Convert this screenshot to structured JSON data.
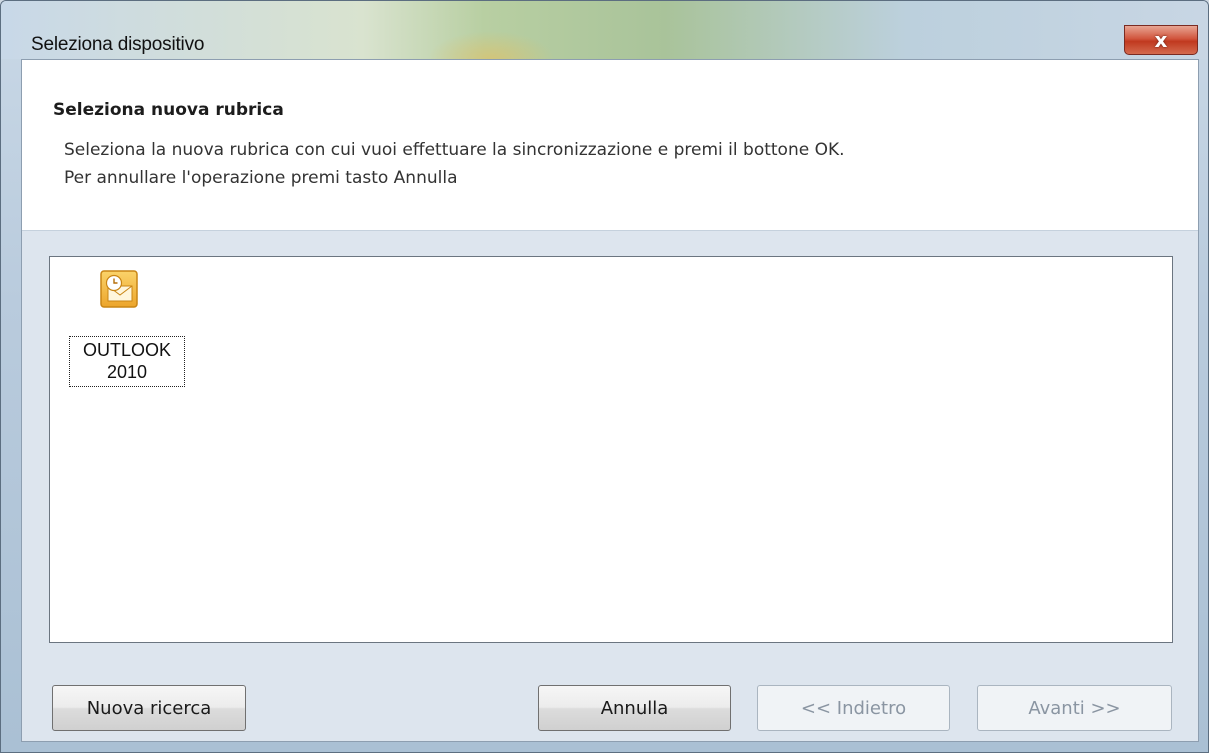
{
  "window": {
    "title": "Seleziona dispositivo",
    "close_label": "x"
  },
  "header": {
    "title": "Seleziona nuova rubrica",
    "line1": "Seleziona la nuova rubrica con cui vuoi effettuare la sincronizzazione e premi il bottone OK.",
    "line2": "Per annullare l'operazione premi tasto Annulla"
  },
  "devices": [
    {
      "label_line1": "OUTLOOK",
      "label_line2": "2010",
      "icon": "outlook-2010-icon"
    }
  ],
  "buttons": {
    "new_search": "Nuova ricerca",
    "cancel": "Annulla",
    "back": "<< Indietro",
    "next": "Avanti >>"
  },
  "colors": {
    "close_button": "#c0391f",
    "icon_orange": "#f2b63f"
  }
}
